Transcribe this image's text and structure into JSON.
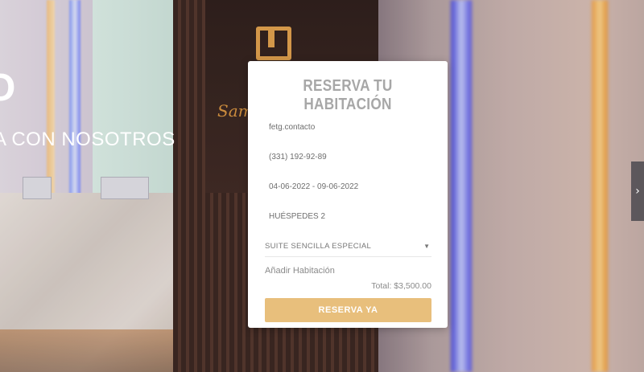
{
  "hero": {
    "title_fragment": "O",
    "subtitle_fragment": "A CON NOSOTROS"
  },
  "background": {
    "logo_text": "Sam"
  },
  "booking": {
    "title": "RESERVA TU HABITACIÓN",
    "fields": {
      "contact": "fetg.contacto",
      "phone": "(331) 192-92-89",
      "dates": "04-06-2022 - 09-06-2022",
      "guests": "HUÉSPEDES 2"
    },
    "room_type": {
      "selected": "SUITE SENCILLA ESPECIAL",
      "caret": "▼"
    },
    "add_room_label": "Añadir Habitación",
    "total": "Total: $3,500.00",
    "cta_label": "RESERVA YA"
  },
  "nav": {
    "next_arrow": "›"
  },
  "colors": {
    "cta": "#e8bf7c",
    "title_gray": "#a7a7a7",
    "logo_gold": "#e2a24d"
  },
  "icons": {
    "next": "chevron-right-icon",
    "dropdown": "caret-down-icon"
  }
}
